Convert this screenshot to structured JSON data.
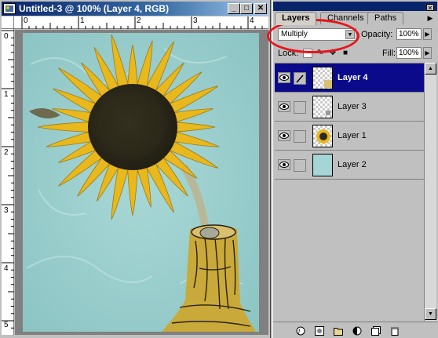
{
  "document": {
    "title": "Untitled-3 @ 100% (Layer 4, RGB)",
    "ruler_top_numbers": [
      "0",
      "1",
      "2",
      "3",
      "4"
    ],
    "ruler_left_numbers": [
      "0",
      "1",
      "2",
      "3",
      "4",
      "5"
    ]
  },
  "palette": {
    "tabs": [
      "Layers",
      "Channels",
      "Paths"
    ],
    "active_tab": "Layers",
    "blend_mode": "Multiply",
    "opacity_label": "Opacity:",
    "opacity_value": "100%",
    "lock_label": "Lock:",
    "fill_label": "Fill:",
    "fill_value": "100%",
    "layers": [
      {
        "name": "Layer 4",
        "selected": true,
        "visible": true
      },
      {
        "name": "Layer 3",
        "selected": false,
        "visible": true
      },
      {
        "name": "Layer 1",
        "selected": false,
        "visible": true
      },
      {
        "name": "Layer 2",
        "selected": false,
        "visible": true
      }
    ]
  },
  "colors": {
    "title_bar": "#08246b",
    "selected_layer": "#0a0a8a",
    "highlight_ring": "#e8151b",
    "canvas_background": "#9fcfcf",
    "sunflower_petal": "#e8b81c",
    "stump": "#c9a93a"
  }
}
